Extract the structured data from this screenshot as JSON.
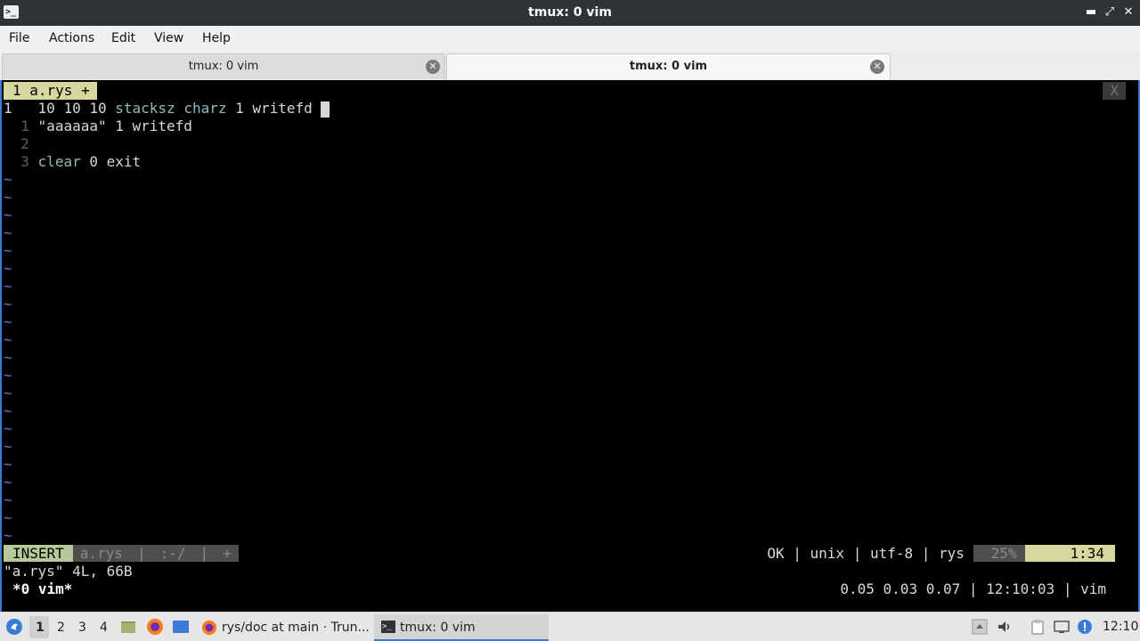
{
  "window": {
    "title": "tmux: 0 vim",
    "app_icon": ">_",
    "minimize_glyph": "▬",
    "maximize_glyph": "⤢",
    "close_glyph": "✕"
  },
  "menu": {
    "items": [
      "File",
      "Actions",
      "Edit",
      "View",
      "Help"
    ]
  },
  "tabs": [
    {
      "label": "tmux: 0 vim",
      "active": false
    },
    {
      "label": "tmux: 0 vim",
      "active": true
    }
  ],
  "vim": {
    "tabline": {
      "active_tab": " 1 a.rys + ",
      "close": "X"
    },
    "lines": [
      {
        "num": "1",
        "code_pre": "10 10 10 ",
        "kw1": "stacksz charz",
        "code_mid": " 1 writefd"
      },
      {
        "num": "1",
        "code_str": "\"aaaaaa\"",
        "code_mid": " 1 writefd"
      },
      {
        "num": "2",
        "code_mid": ""
      },
      {
        "num": "3",
        "kw1": "clear",
        "code_mid": " 0 exit"
      }
    ],
    "tilde": "~",
    "status": {
      "mode": "INSERT",
      "file": "a.rys",
      "sep1": "|",
      "dir": ":-/",
      "sep2": "|",
      "modified": "+",
      "right": "OK | unix | utf-8 | rys",
      "percent": "25%",
      "position": "1:34"
    },
    "message": "\"a.rys\" 4L, 66B"
  },
  "tmux": {
    "window_label": "*0 vim*",
    "right": "0.05 0.03 0.07 | 12:10:03 | vim"
  },
  "taskbar": {
    "desktops": [
      "1",
      "2",
      "3",
      "4"
    ],
    "active_desktop": "1",
    "tasks": [
      {
        "label": "rys/doc at main · Trun...",
        "icon": "firefox-icon"
      },
      {
        "label": "tmux: 0 vim",
        "icon": "terminal-icon"
      }
    ],
    "clock": "12:10"
  },
  "colors": {
    "window_border": "#3a7bd5",
    "insert_mode": "#b5c99a",
    "tilde": "#4a7fc0",
    "keyword": "#8fbcbb"
  }
}
